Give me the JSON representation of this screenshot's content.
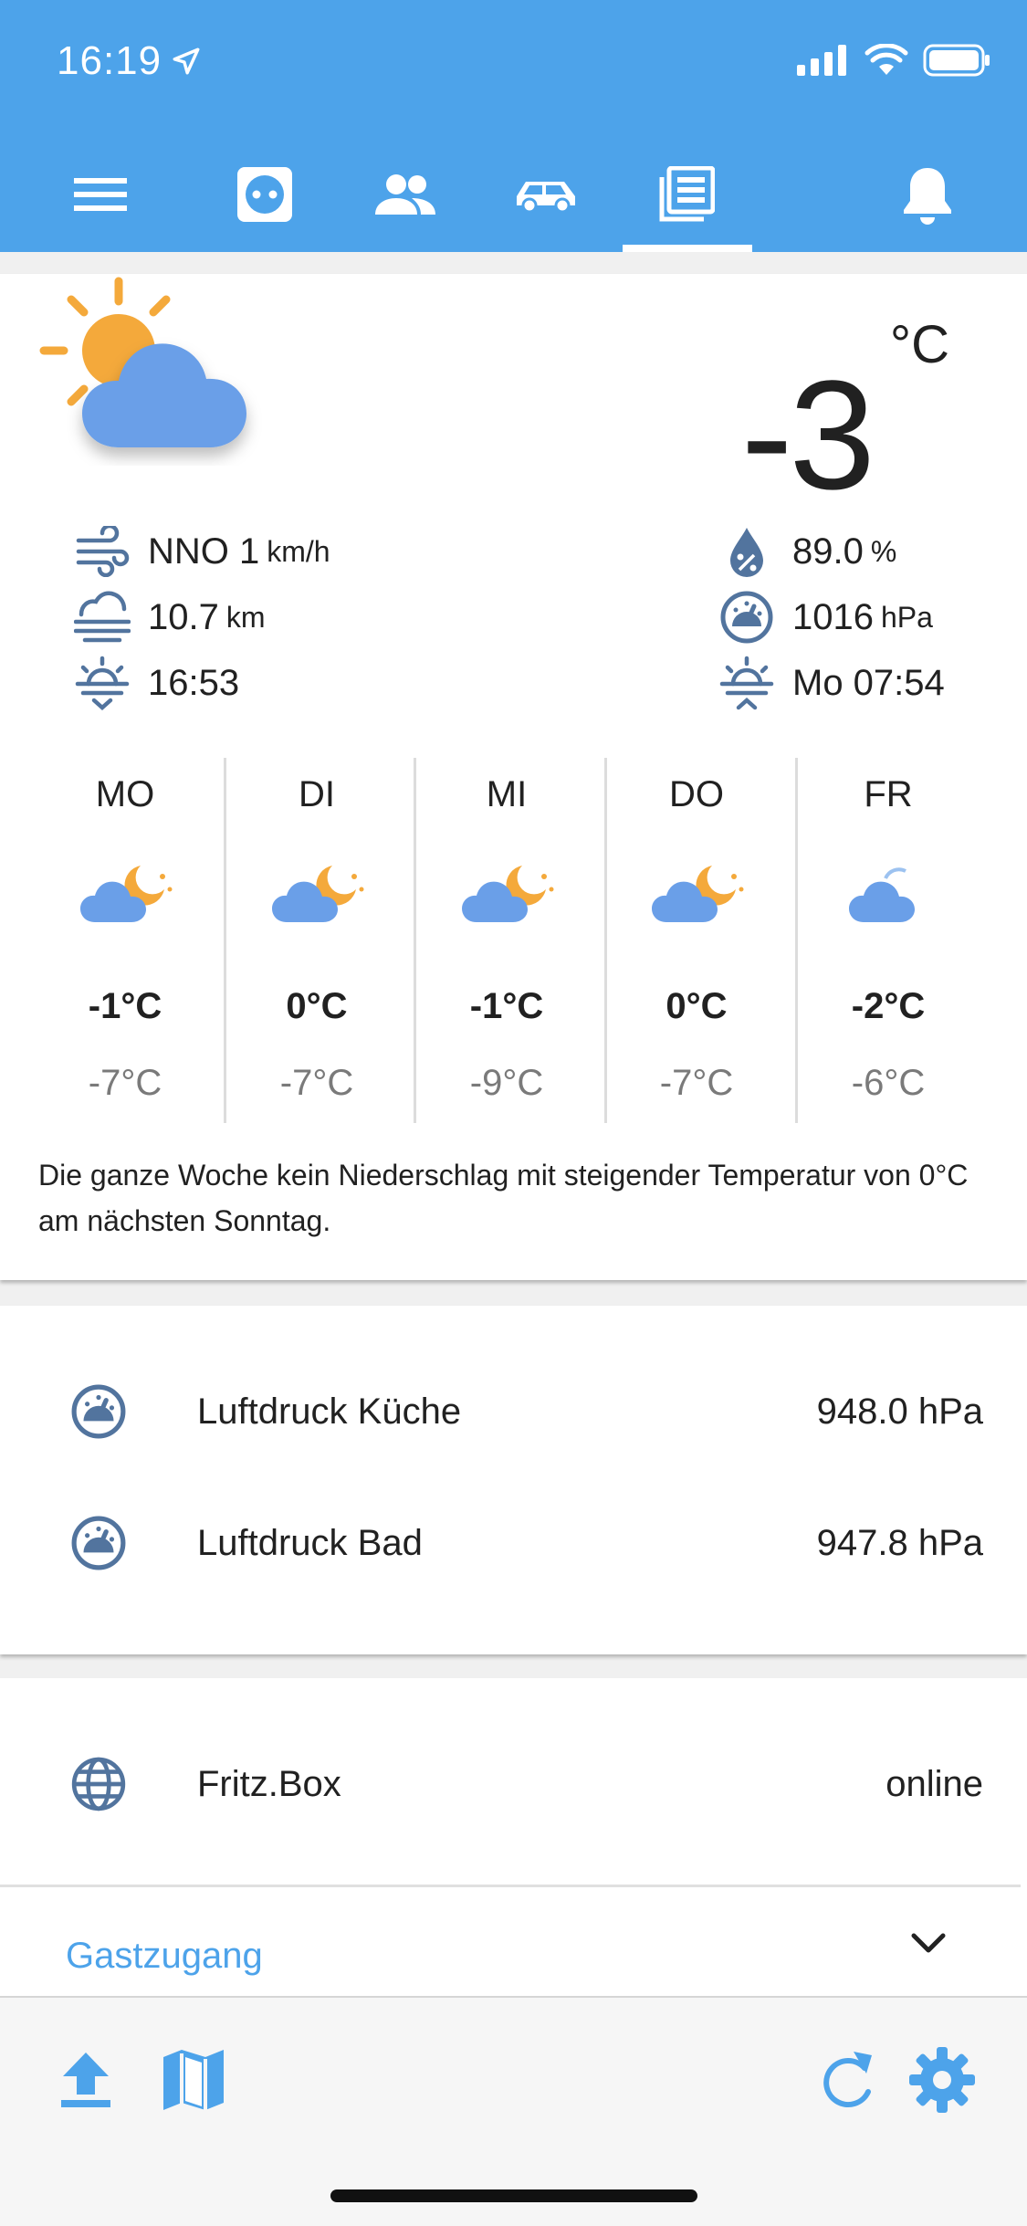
{
  "status_bar": {
    "time": "16:19"
  },
  "colors": {
    "accent": "#4da3ea",
    "icon_blue": "#52749e",
    "sun": "#f4a93b",
    "cloud": "#6a9fe8"
  },
  "tabs": [
    {
      "icon": "menu-icon"
    },
    {
      "icon": "socket-icon"
    },
    {
      "icon": "people-icon"
    },
    {
      "icon": "car-icon"
    },
    {
      "icon": "newspaper-icon",
      "active": true
    },
    {
      "icon": "bell-icon"
    }
  ],
  "weather": {
    "current_icon": "partly-cloudy-day-icon",
    "temperature": "-3",
    "temperature_unit": "°C",
    "wind": {
      "value": "NNO 1",
      "unit": "km/h"
    },
    "visibility": {
      "value": "10.7",
      "unit": "km"
    },
    "sunset": {
      "value": "16:53"
    },
    "humidity": {
      "value": "89.0",
      "unit": "%"
    },
    "pressure": {
      "value": "1016",
      "unit": "hPa"
    },
    "sunrise": {
      "value": "Mo 07:54"
    },
    "forecast": [
      {
        "day": "MO",
        "high": "-1°C",
        "low": "-7°C",
        "icon": "partly-cloudy-night-icon"
      },
      {
        "day": "DI",
        "high": "0°C",
        "low": "-7°C",
        "icon": "partly-cloudy-night-icon"
      },
      {
        "day": "MI",
        "high": "-1°C",
        "low": "-9°C",
        "icon": "partly-cloudy-night-icon"
      },
      {
        "day": "DO",
        "high": "0°C",
        "low": "-7°C",
        "icon": "partly-cloudy-night-icon"
      },
      {
        "day": "FR",
        "high": "-2°C",
        "low": "-6°C",
        "icon": "cloudy-icon"
      }
    ],
    "summary": "Die ganze Woche kein Niederschlag mit steigender Temperatur von 0°C am nächsten Sonntag."
  },
  "sensors": [
    {
      "label": "Luftdruck Küche",
      "value": "948.0 hPa",
      "icon": "gauge-icon"
    },
    {
      "label": "Luftdruck Bad",
      "value": "947.8 hPa",
      "icon": "gauge-icon"
    }
  ],
  "network": {
    "label": "Fritz.Box",
    "value": "online",
    "icon": "globe-icon",
    "guest_label": "Gastzugang"
  },
  "bottom_bar": {
    "left": [
      "upload-icon",
      "map-icon"
    ],
    "right": [
      "refresh-icon",
      "settings-icon"
    ]
  }
}
